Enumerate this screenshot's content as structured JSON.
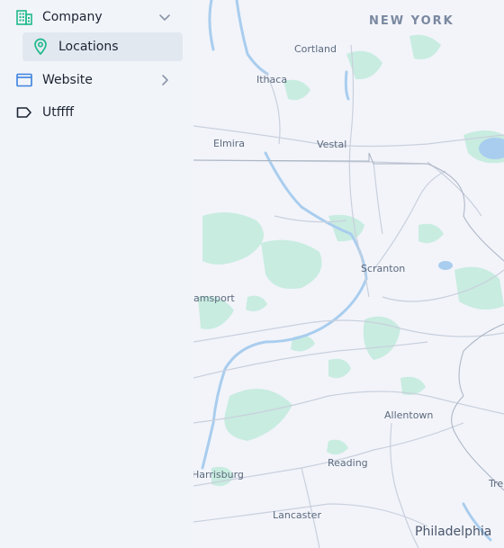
{
  "sidebar": {
    "items": [
      {
        "label": "Company",
        "icon": "building-icon",
        "expanded": true
      },
      {
        "label": "Locations",
        "icon": "map-pin-icon",
        "selected": true
      },
      {
        "label": "Website",
        "icon": "window-icon",
        "expanded": false
      },
      {
        "label": "Utffff",
        "icon": "tag-icon"
      }
    ]
  },
  "map": {
    "labels": {
      "state_ny": "NEW YORK",
      "cortland": "Cortland",
      "ithaca": "Ithaca",
      "elmira": "Elmira",
      "vestal": "Vestal",
      "scranton": "Scranton",
      "williamsport": "amsport",
      "allentown": "Allentown",
      "reading": "Reading",
      "harrisburg": "Harrisburg",
      "lancaster": "Lancaster",
      "philadelphia": "Philadelphia",
      "trenton": "Tre"
    }
  },
  "colors": {
    "accent": "#1fb98a",
    "water": "#a9cdee",
    "forest": "#c8ece0",
    "road": "#c9d0dc",
    "sidebar_bg": "#f1f4f9",
    "selected_bg": "#e2e8f0"
  }
}
